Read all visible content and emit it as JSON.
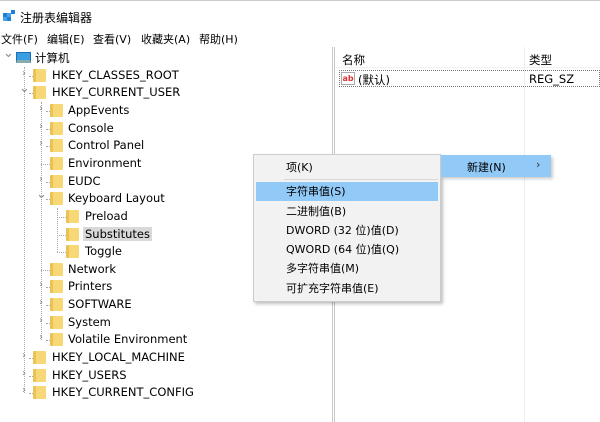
{
  "window": {
    "title": "注册表编辑器"
  },
  "menubar": [
    "文件(F)",
    "编辑(E)",
    "查看(V)",
    "收藏夹(A)",
    "帮助(H)"
  ],
  "tree": [
    {
      "label": "计算机",
      "level": 0,
      "expander": "expanded",
      "icon": "computer-icon"
    },
    {
      "label": "HKEY_CLASSES_ROOT",
      "level": 1,
      "expander": "collapsed"
    },
    {
      "label": "HKEY_CURRENT_USER",
      "level": 1,
      "expander": "expanded"
    },
    {
      "label": "AppEvents",
      "level": 2,
      "expander": "collapsed"
    },
    {
      "label": "Console",
      "level": 2,
      "expander": "collapsed"
    },
    {
      "label": "Control Panel",
      "level": 2,
      "expander": "collapsed"
    },
    {
      "label": "Environment",
      "level": 2,
      "expander": "none"
    },
    {
      "label": "EUDC",
      "level": 2,
      "expander": "collapsed"
    },
    {
      "label": "Keyboard Layout",
      "level": 2,
      "expander": "expanded"
    },
    {
      "label": "Preload",
      "level": 3,
      "expander": "none"
    },
    {
      "label": "Substitutes",
      "level": 3,
      "expander": "none",
      "selected": true
    },
    {
      "label": "Toggle",
      "level": 3,
      "expander": "none"
    },
    {
      "label": "Network",
      "level": 2,
      "expander": "none"
    },
    {
      "label": "Printers",
      "level": 2,
      "expander": "collapsed"
    },
    {
      "label": "SOFTWARE",
      "level": 2,
      "expander": "collapsed"
    },
    {
      "label": "System",
      "level": 2,
      "expander": "collapsed"
    },
    {
      "label": "Volatile Environment",
      "level": 2,
      "expander": "collapsed"
    },
    {
      "label": "HKEY_LOCAL_MACHINE",
      "level": 1,
      "expander": "collapsed"
    },
    {
      "label": "HKEY_USERS",
      "level": 1,
      "expander": "collapsed"
    },
    {
      "label": "HKEY_CURRENT_CONFIG",
      "level": 1,
      "expander": "collapsed"
    }
  ],
  "values_pane": {
    "columns": [
      "名称",
      "类型"
    ],
    "rows": [
      {
        "name": "(默认)",
        "type": "REG_SZ",
        "icon_text": "ab"
      }
    ]
  },
  "context_menu": {
    "parent_item": "新建(N)",
    "parent_arrow": "›",
    "items": [
      "项(K)",
      "字符串值(S)",
      "二进制值(B)",
      "DWORD (32 位)值(D)",
      "QWORD (64 位)值(Q)",
      "多字符串值(M)",
      "可扩充字符串值(E)"
    ],
    "highlighted_index": 1
  },
  "colors": {
    "highlight": "#91c9f7",
    "folder": "#f8d777",
    "menu_bg": "#f2f2f2"
  }
}
